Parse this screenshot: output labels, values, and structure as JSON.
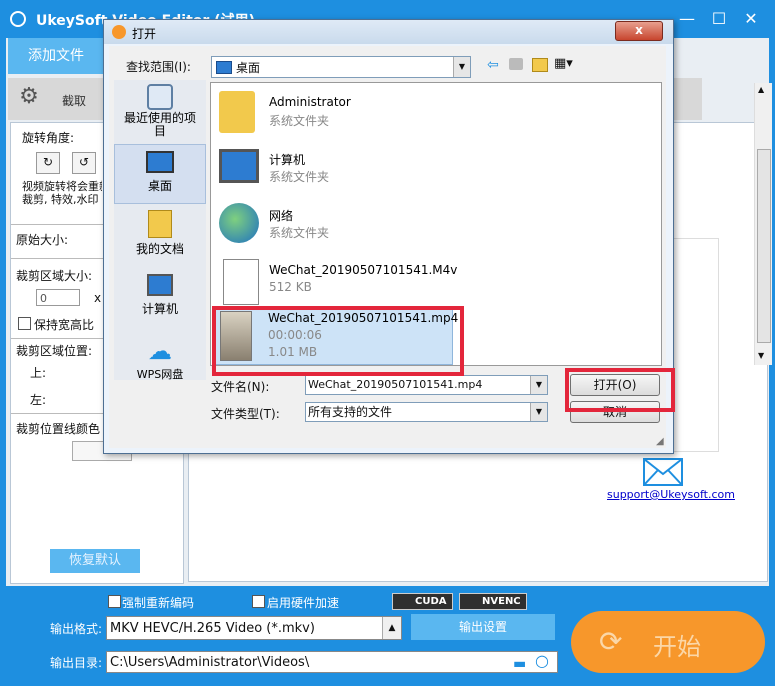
{
  "app": {
    "title": "UkeySoft Video Editor (试用)",
    "add_file_tab": "添加文件",
    "crop_tab": "截取",
    "window_controls": [
      "minimize-icon",
      "maximize-icon",
      "close-icon"
    ]
  },
  "left_panel": {
    "rotate_label": "旋转角度:",
    "rotate_note": "视频旋转将会重新编码\n裁剪, 特效,水印",
    "orig_size_label": "原始大小:",
    "crop_size_label": "裁剪区域大小:",
    "crop_width_value": "0",
    "keep_ratio_label": "保持宽高比",
    "crop_pos_label": "裁剪区域位置:",
    "top_label": "上:",
    "left_label": "左:",
    "line_color_label": "裁剪位置线颜色",
    "restore_button": "恢复默认"
  },
  "preview": {
    "support_link": "support@Ukeysoft.com"
  },
  "bottom": {
    "force_reencode_label": "强制重新编码",
    "hw_accel_label": "启用硬件加速",
    "cuda_label": "CUDA",
    "nvenc_label": "NVENC",
    "output_format_label": "输出格式:",
    "output_format_value": "MKV HEVC/H.265 Video (*.mkv)",
    "output_settings_button": "输出设置",
    "output_dir_label": "输出目录:",
    "output_dir_value": "C:\\Users\\Administrator\\Videos\\",
    "start_button": "开始"
  },
  "dialog": {
    "title": "打开",
    "close_label": "x",
    "look_in_label": "查找范围(I):",
    "look_in_value": "桌面",
    "places": [
      {
        "label": "最近使用的项目",
        "icon": "recent-icon"
      },
      {
        "label": "桌面",
        "icon": "desktop-icon"
      },
      {
        "label": "我的文档",
        "icon": "documents-icon"
      },
      {
        "label": "计算机",
        "icon": "computer-icon"
      },
      {
        "label": "WPS网盘",
        "icon": "cloud-icon"
      }
    ],
    "files": [
      {
        "name": "Administrator",
        "sub": "系统文件夹",
        "icon": "user-folder-icon"
      },
      {
        "name": "计算机",
        "sub": "系统文件夹",
        "icon": "computer-icon"
      },
      {
        "name": "网络",
        "sub": "系统文件夹",
        "icon": "network-icon"
      },
      {
        "name": "WeChat_20190507101541.M4v",
        "sub": "512 KB",
        "icon": "video-file-icon"
      },
      {
        "name": "WeChat_20190507101541.mp4",
        "sub": "00:00:06",
        "sub2": "1.01 MB",
        "icon": "video-thumbnail-icon"
      }
    ],
    "filename_label": "文件名(N):",
    "filename_value": "WeChat_20190507101541.mp4",
    "filetype_label": "文件类型(T):",
    "filetype_value": "所有支持的文件",
    "open_button": "打开(O)",
    "cancel_button": "取消"
  },
  "colors": {
    "brand_blue": "#1e8fe0",
    "tab_blue": "#5ab7f0",
    "start_orange": "#f7972b",
    "highlight_red": "#e3263b"
  }
}
